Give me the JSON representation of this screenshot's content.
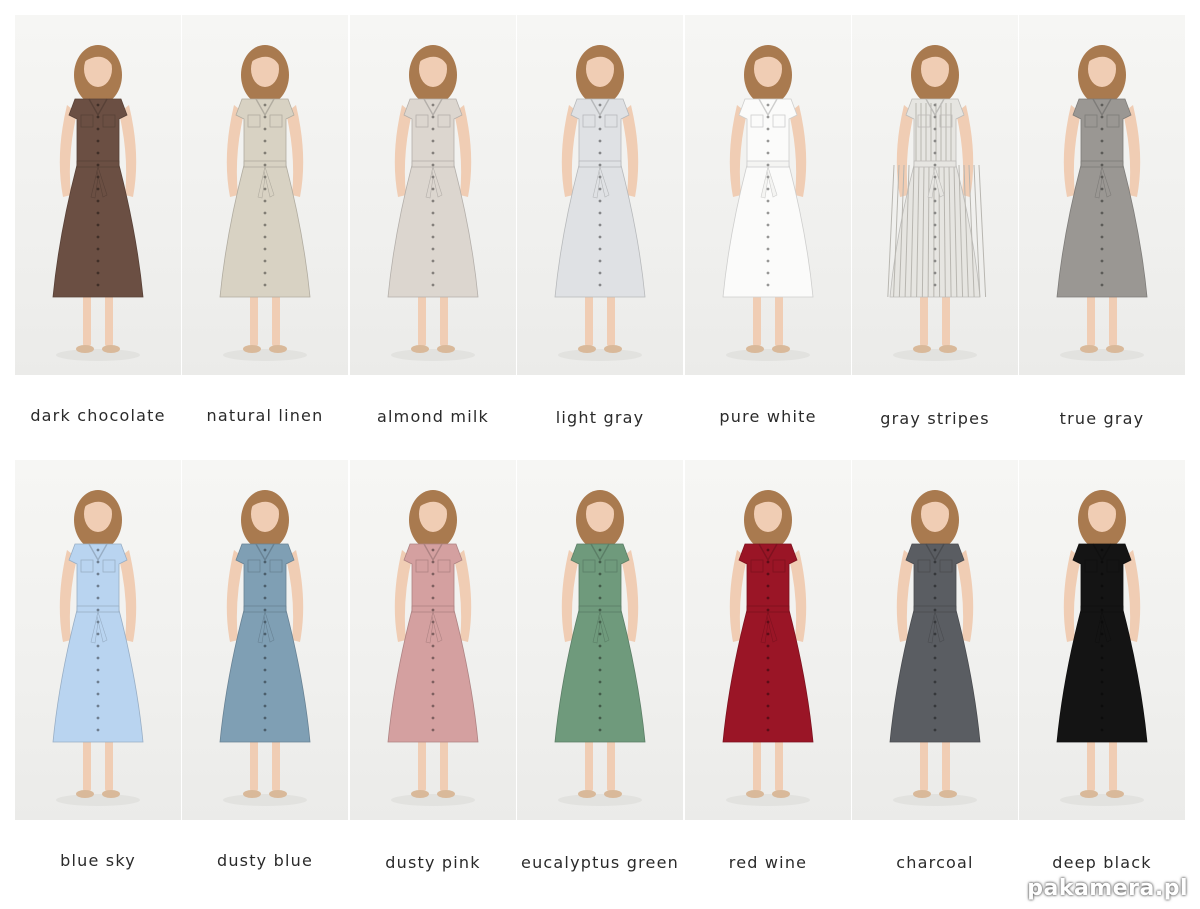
{
  "swatches": [
    {
      "label": "dark chocolate",
      "dress": "#6b4f43",
      "belt": "#6b4f43"
    },
    {
      "label": "natural linen",
      "dress": "#d8d2c3",
      "belt": "#d8d2c3"
    },
    {
      "label": "almond milk",
      "dress": "#dcd6cf",
      "belt": "#dcd6cf"
    },
    {
      "label": "light gray",
      "dress": "#dfe1e4",
      "belt": "#dfe1e4"
    },
    {
      "label": "pure white",
      "dress": "#fbfbfa",
      "belt": "#f4f4f2"
    },
    {
      "label": "gray stripes",
      "dress": "#e6e5e1",
      "belt": "#e6e5e1"
    },
    {
      "label": "true gray",
      "dress": "#9a9793",
      "belt": "#9a9793"
    },
    {
      "label": "blue sky",
      "dress": "#b9d4f0",
      "belt": "#b9d4f0"
    },
    {
      "label": "dusty blue",
      "dress": "#7f9fb4",
      "belt": "#7f9fb4"
    },
    {
      "label": "dusty pink",
      "dress": "#d4a0a0",
      "belt": "#d4a0a0"
    },
    {
      "label": "eucalyptus green",
      "dress": "#6f9a7c",
      "belt": "#6f9a7c"
    },
    {
      "label": "red wine",
      "dress": "#9a1526",
      "belt": "#9a1526"
    },
    {
      "label": "charcoal",
      "dress": "#5a5d62",
      "belt": "#5a5d62"
    },
    {
      "label": "deep black",
      "dress": "#141414",
      "belt": "#141414"
    }
  ],
  "watermark": "pakamera.pl"
}
